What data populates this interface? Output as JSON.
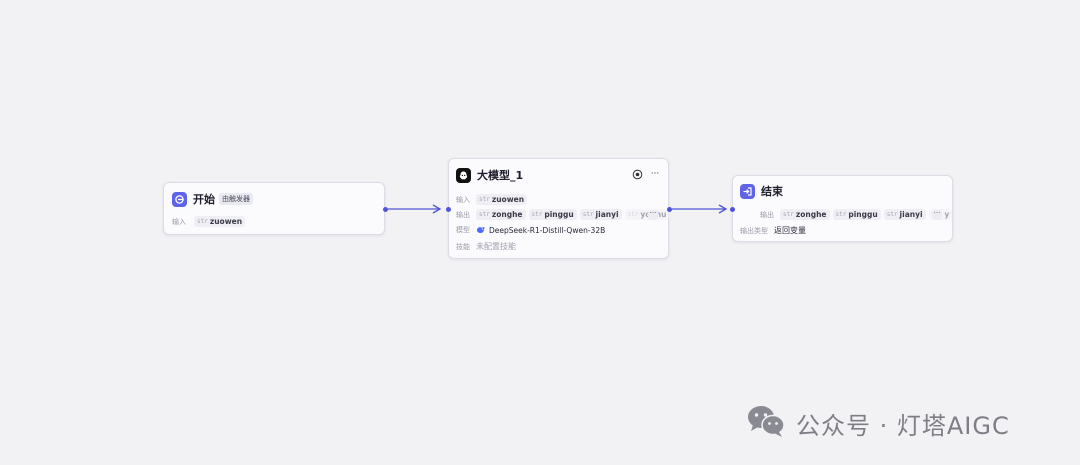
{
  "colors": {
    "accent": "#4f55d8",
    "start_icon_bg": "#5f63e8",
    "end_icon_bg": "#5f63e8",
    "canvas_bg": "#f2f2f5"
  },
  "start_node": {
    "title": "开始",
    "badge": "由触发器",
    "icon": "start-icon",
    "input": {
      "label": "输入",
      "vars": [
        {
          "type": "str",
          "name": "zuowen"
        }
      ]
    }
  },
  "llm_node": {
    "title": "大模型_1",
    "icon": "llm-icon",
    "input": {
      "label": "输入",
      "vars": [
        {
          "type": "str",
          "name": "zuowen"
        }
      ]
    },
    "output": {
      "label": "输出",
      "vars": [
        {
          "type": "str",
          "name": "zonghe"
        },
        {
          "type": "str",
          "name": "pinggu"
        },
        {
          "type": "str",
          "name": "jianyi"
        },
        {
          "type": "str",
          "name": "youhu"
        }
      ],
      "more": "···"
    },
    "model": {
      "label": "模型",
      "value": "DeepSeek-R1-Distill-Qwen-32B"
    },
    "skills": {
      "label": "技能",
      "value": "未配置技能"
    },
    "menu": "···"
  },
  "end_node": {
    "title": "结束",
    "icon": "end-icon",
    "output": {
      "label": "输出",
      "vars": [
        {
          "type": "str",
          "name": "zonghe"
        },
        {
          "type": "str",
          "name": "pinggu"
        },
        {
          "type": "str",
          "name": "jianyi"
        },
        {
          "type": "str",
          "name": "y"
        }
      ],
      "more": "···"
    },
    "output_type": {
      "label": "输出类型",
      "value": "返回变量"
    }
  },
  "watermark": {
    "text": "公众号 · 灯塔AIGC"
  }
}
